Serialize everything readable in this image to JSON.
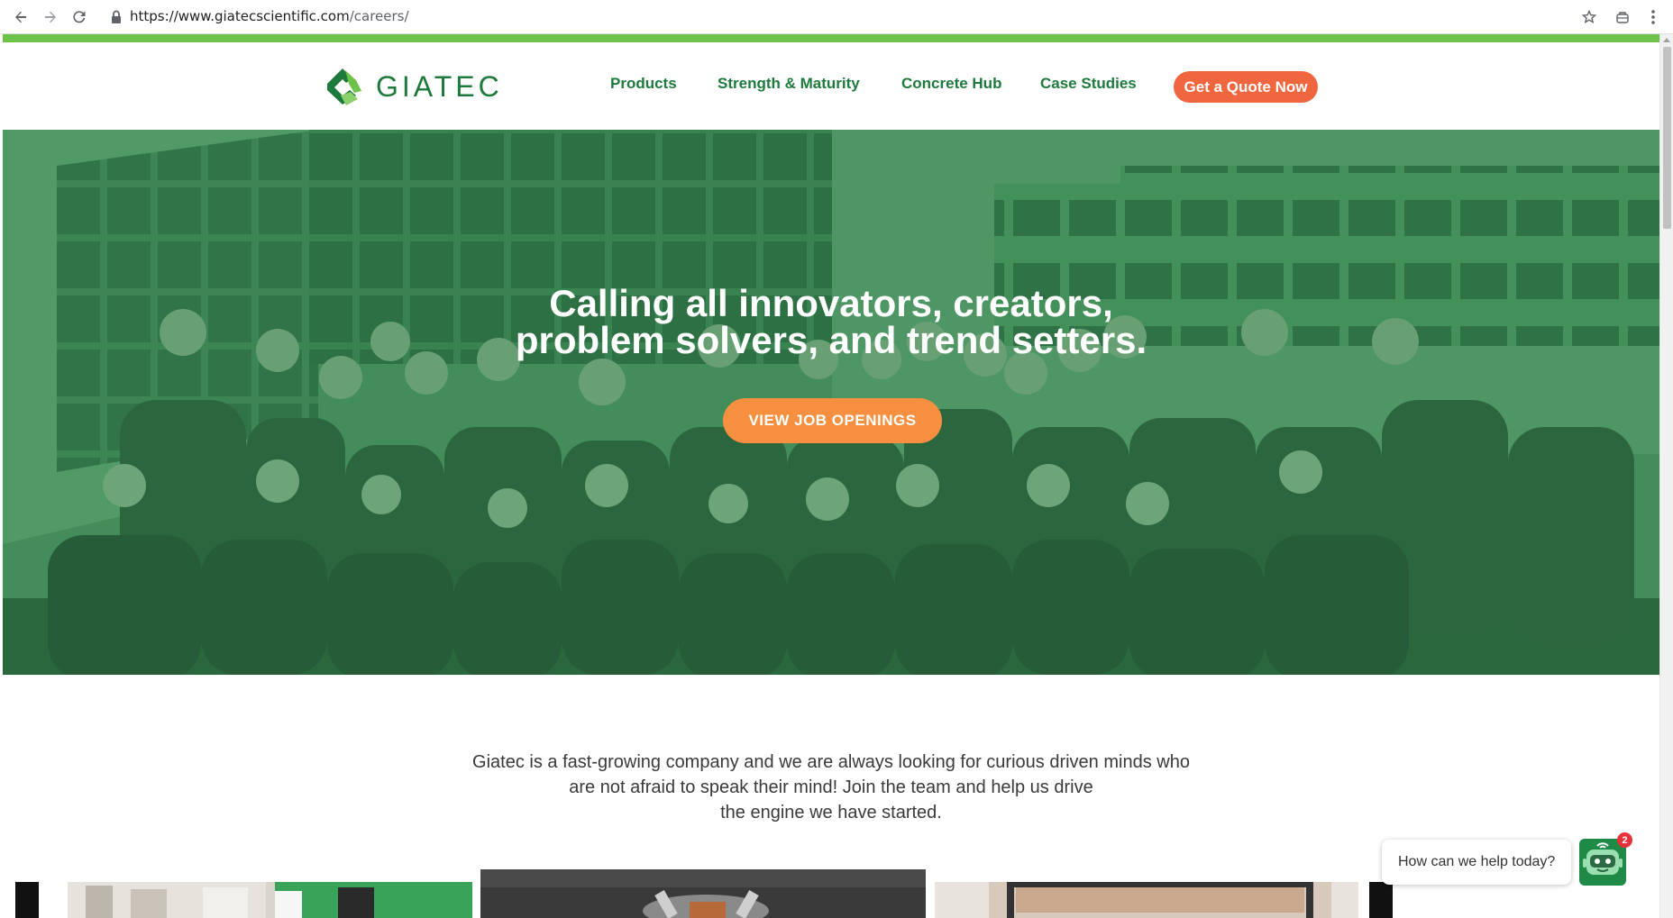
{
  "browser": {
    "url_host": "https://www.giatecscientific.com",
    "url_path": "/careers/",
    "back_icon": "arrow-left-icon",
    "forward_icon": "arrow-right-icon",
    "reload_icon": "reload-icon",
    "star_icon": "star-icon",
    "extension_icon": "extension-icon",
    "menu_icon": "kebab-menu-icon"
  },
  "header": {
    "logo_text": "GIATEC",
    "nav": [
      "Products",
      "Strength & Maturity",
      "Concrete Hub",
      "Case Studies"
    ],
    "cta_label": "Get a Quote Now"
  },
  "hero": {
    "title_line1": "Calling all innovators, creators,",
    "title_line2": "problem solvers, and trend setters.",
    "button_label": "VIEW JOB OPENINGS"
  },
  "intro": {
    "line1": "Giatec is a fast-growing company and we are always looking for curious driven minds who",
    "line2": "are not afraid to speak their mind! Join the team and help us drive",
    "line3": "the engine we have started."
  },
  "chat": {
    "prompt": "How can we help today?",
    "badge_count": "2"
  },
  "colors": {
    "brand_green": "#1e7a3c",
    "accent_green": "#6cc24a",
    "cta_orange": "#f0663e",
    "hero_button_orange": "#f69040"
  }
}
